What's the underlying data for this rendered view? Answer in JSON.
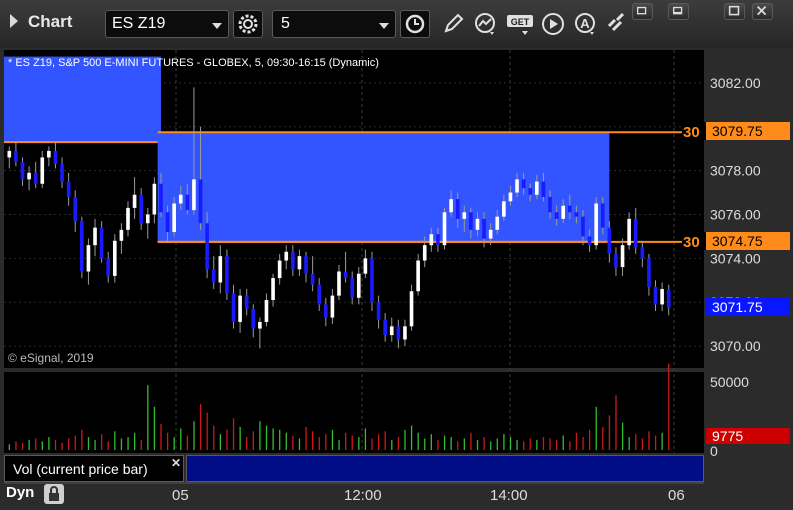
{
  "app": {
    "title": "Chart",
    "symbol": "ES Z19",
    "interval": "5"
  },
  "toolbar": {
    "icons": [
      "gear-icon",
      "clock-icon",
      "pencil-icon",
      "study-icon",
      "get-icon",
      "play-icon",
      "alert-icon",
      "link-icon"
    ],
    "get_label": "GET"
  },
  "window_controls": [
    "restore-icon",
    "minimize-icon",
    "maximize-icon",
    "close-icon"
  ],
  "chart_info": "* ES Z19, S&P 500 E-MINI FUTURES - GLOBEX, 5, 09:30-16:15 (Dynamic)",
  "copyright": "© eSignal, 2019",
  "price_axis": {
    "ticks": [
      "3082.00",
      "3080.00",
      "3078.00",
      "3076.00",
      "3074.00",
      "3072.00",
      "3070.00"
    ],
    "upper_label": "3079.75",
    "lower_label": "3074.75",
    "current_label": "3071.75",
    "box_prefix": "30"
  },
  "volume_axis": {
    "ticks": [
      "50000",
      "0"
    ],
    "current_label": "9775",
    "title": "Vol (current price bar)"
  },
  "time_axis": {
    "ticks": [
      "05",
      "12:00",
      "14:00",
      "06"
    ]
  },
  "status": {
    "mode": "Dyn"
  },
  "colors": {
    "background": "#000000",
    "up_candle": "#ffffff",
    "down_candle": "#1a1aff",
    "zone": "#3355ff",
    "zone_line": "#ff8c1a",
    "upper_label_bg": "#ff8c1a",
    "current_label_bg": "#0a16ff",
    "volume_current_bg": "#cc0000",
    "vol_up": "#2fbf2f",
    "vol_down": "#d01818"
  },
  "chart_data": {
    "type": "candlestick",
    "title": "* ES Z19, S&P 500 E-MINI FUTURES - GLOBEX, 5, 09:30-16:15 (Dynamic)",
    "ylim": [
      3069.0,
      3083.5
    ],
    "x_ticks": [
      "05",
      "12:00",
      "14:00",
      "06"
    ],
    "zones": [
      {
        "y_high": 3083.2,
        "y_low": 3079.3,
        "x_start_bar": 0,
        "x_end_bar": 23
      },
      {
        "y_high": 3079.75,
        "y_low": 3074.75,
        "x_start_bar": 23,
        "x_end_bar": 91
      }
    ],
    "candles": [
      [
        3078.6,
        3079.1,
        3078.1,
        3078.9
      ],
      [
        3078.9,
        3079.3,
        3078.2,
        3078.4
      ],
      [
        3078.4,
        3078.6,
        3077.3,
        3077.6
      ],
      [
        3077.6,
        3078.2,
        3077.1,
        3077.9
      ],
      [
        3077.9,
        3078.4,
        3077.2,
        3077.4
      ],
      [
        3077.4,
        3078.9,
        3077.2,
        3078.6
      ],
      [
        3078.6,
        3079.1,
        3078.2,
        3078.9
      ],
      [
        3078.9,
        3079.3,
        3078.1,
        3078.3
      ],
      [
        3078.3,
        3078.6,
        3077.2,
        3077.5
      ],
      [
        3077.5,
        3077.9,
        3076.4,
        3076.8
      ],
      [
        3076.8,
        3077.1,
        3075.2,
        3075.7
      ],
      [
        3075.7,
        3075.9,
        3073.1,
        3073.4
      ],
      [
        3073.4,
        3074.9,
        3072.8,
        3074.6
      ],
      [
        3074.6,
        3075.8,
        3074.1,
        3075.4
      ],
      [
        3075.4,
        3075.7,
        3073.8,
        3074.0
      ],
      [
        3074.0,
        3074.3,
        3072.9,
        3073.2
      ],
      [
        3073.2,
        3075.1,
        3072.9,
        3074.8
      ],
      [
        3074.8,
        3075.6,
        3074.2,
        3075.3
      ],
      [
        3075.3,
        3076.6,
        3075.0,
        3076.3
      ],
      [
        3076.3,
        3077.7,
        3075.8,
        3076.9
      ],
      [
        3076.9,
        3077.2,
        3075.3,
        3075.6
      ],
      [
        3075.6,
        3076.3,
        3074.9,
        3076.0
      ],
      [
        3076.0,
        3077.7,
        3075.6,
        3077.4
      ],
      [
        3077.4,
        3077.9,
        3075.9,
        3076.1
      ],
      [
        3076.1,
        3076.4,
        3074.8,
        3075.2
      ],
      [
        3075.2,
        3076.8,
        3075.0,
        3076.5
      ],
      [
        3076.5,
        3077.3,
        3076.2,
        3076.9
      ],
      [
        3076.9,
        3077.4,
        3076.0,
        3076.2
      ],
      [
        3076.2,
        3081.8,
        3076.0,
        3077.6
      ],
      [
        3077.6,
        3080.0,
        3075.3,
        3075.6
      ],
      [
        3075.6,
        3076.1,
        3073.1,
        3073.5
      ],
      [
        3073.5,
        3074.1,
        3072.6,
        3072.9
      ],
      [
        3072.9,
        3074.6,
        3072.4,
        3074.1
      ],
      [
        3074.1,
        3074.4,
        3072.1,
        3072.4
      ],
      [
        3072.4,
        3072.8,
        3070.8,
        3071.1
      ],
      [
        3071.1,
        3072.6,
        3070.6,
        3072.3
      ],
      [
        3072.3,
        3072.6,
        3071.4,
        3071.7
      ],
      [
        3071.7,
        3071.9,
        3070.4,
        3070.8
      ],
      [
        3070.8,
        3071.3,
        3069.9,
        3071.1
      ],
      [
        3071.1,
        3072.4,
        3070.9,
        3072.1
      ],
      [
        3072.1,
        3073.3,
        3071.8,
        3073.1
      ],
      [
        3073.1,
        3074.2,
        3072.8,
        3073.9
      ],
      [
        3073.9,
        3074.6,
        3073.5,
        3074.3
      ],
      [
        3074.3,
        3074.6,
        3073.2,
        3073.5
      ],
      [
        3073.5,
        3074.4,
        3073.2,
        3074.1
      ],
      [
        3074.1,
        3074.3,
        3072.9,
        3073.3
      ],
      [
        3073.3,
        3074.1,
        3072.5,
        3072.8
      ],
      [
        3072.8,
        3073.1,
        3071.6,
        3071.9
      ],
      [
        3071.9,
        3072.2,
        3070.9,
        3071.3
      ],
      [
        3071.3,
        3072.6,
        3071.0,
        3072.3
      ],
      [
        3072.3,
        3073.7,
        3072.1,
        3073.4
      ],
      [
        3073.4,
        3074.3,
        3072.9,
        3073.1
      ],
      [
        3073.1,
        3073.4,
        3071.9,
        3072.2
      ],
      [
        3072.2,
        3073.6,
        3071.9,
        3073.3
      ],
      [
        3073.3,
        3074.4,
        3073.1,
        3074.0
      ],
      [
        3074.0,
        3074.3,
        3071.6,
        3072.0
      ],
      [
        3072.0,
        3072.3,
        3070.8,
        3071.2
      ],
      [
        3071.2,
        3071.5,
        3070.2,
        3070.5
      ],
      [
        3070.5,
        3071.3,
        3070.2,
        3070.9
      ],
      [
        3070.9,
        3071.2,
        3069.9,
        3070.3
      ],
      [
        3070.3,
        3071.2,
        3070.0,
        3070.9
      ],
      [
        3070.9,
        3072.8,
        3070.7,
        3072.5
      ],
      [
        3072.5,
        3074.2,
        3072.3,
        3073.9
      ],
      [
        3073.9,
        3075.0,
        3073.6,
        3074.6
      ],
      [
        3074.6,
        3075.4,
        3074.3,
        3075.1
      ],
      [
        3075.1,
        3075.4,
        3074.3,
        3074.6
      ],
      [
        3074.6,
        3076.3,
        3074.4,
        3076.1
      ],
      [
        3076.1,
        3077.1,
        3075.9,
        3076.7
      ],
      [
        3076.7,
        3077.0,
        3075.4,
        3075.8
      ],
      [
        3075.8,
        3076.4,
        3075.2,
        3076.1
      ],
      [
        3076.1,
        3076.3,
        3074.9,
        3075.3
      ],
      [
        3075.3,
        3076.1,
        3075.0,
        3075.8
      ],
      [
        3075.8,
        3076.1,
        3074.5,
        3074.9
      ],
      [
        3074.9,
        3075.6,
        3074.6,
        3075.3
      ],
      [
        3075.3,
        3076.2,
        3075.1,
        3075.9
      ],
      [
        3075.9,
        3076.9,
        3075.7,
        3076.6
      ],
      [
        3076.6,
        3077.3,
        3076.4,
        3077.0
      ],
      [
        3077.0,
        3077.9,
        3076.8,
        3077.6
      ],
      [
        3077.6,
        3077.9,
        3076.9,
        3077.2
      ],
      [
        3077.2,
        3077.4,
        3076.6,
        3076.9
      ],
      [
        3076.9,
        3077.8,
        3076.7,
        3077.5
      ],
      [
        3077.5,
        3077.9,
        3076.6,
        3076.8
      ],
      [
        3076.8,
        3077.1,
        3075.8,
        3076.1
      ],
      [
        3076.1,
        3076.4,
        3075.5,
        3075.8
      ],
      [
        3075.8,
        3076.7,
        3075.6,
        3076.4
      ],
      [
        3076.4,
        3076.9,
        3075.8,
        3076.1
      ],
      [
        3076.1,
        3076.4,
        3075.6,
        3075.9
      ],
      [
        3075.9,
        3076.2,
        3074.6,
        3075.0
      ],
      [
        3075.0,
        3075.3,
        3074.3,
        3074.6
      ],
      [
        3074.6,
        3076.8,
        3074.4,
        3076.5
      ],
      [
        3076.5,
        3076.8,
        3075.1,
        3075.4
      ],
      [
        3075.4,
        3075.7,
        3073.8,
        3074.2
      ],
      [
        3074.2,
        3074.5,
        3073.2,
        3073.6
      ],
      [
        3073.6,
        3074.9,
        3073.2,
        3074.6
      ],
      [
        3074.6,
        3076.1,
        3074.4,
        3075.8
      ],
      [
        3075.8,
        3076.3,
        3074.2,
        3074.5
      ],
      [
        3074.5,
        3074.8,
        3073.6,
        3074.0
      ],
      [
        3074.0,
        3074.2,
        3072.3,
        3072.7
      ],
      [
        3072.7,
        3073.0,
        3071.6,
        3071.9
      ],
      [
        3071.9,
        3072.9,
        3071.6,
        3072.6
      ],
      [
        3072.6,
        3072.8,
        3071.4,
        3071.75
      ]
    ],
    "volume": [
      4,
      6,
      5,
      7,
      8,
      6,
      9,
      7,
      5,
      8,
      10,
      14,
      9,
      7,
      11,
      6,
      13,
      8,
      9,
      12,
      7,
      45,
      30,
      18,
      12,
      9,
      15,
      10,
      20,
      32,
      26,
      17,
      11,
      14,
      22,
      16,
      9,
      13,
      20,
      17,
      15,
      14,
      12,
      10,
      8,
      16,
      13,
      9,
      11,
      14,
      7,
      12,
      10,
      9,
      15,
      8,
      11,
      13,
      7,
      9,
      14,
      17,
      12,
      8,
      11,
      7,
      10,
      9,
      6,
      8,
      12,
      7,
      9,
      6,
      8,
      11,
      9,
      7,
      6,
      8,
      7,
      9,
      8,
      7,
      10,
      6,
      12,
      9,
      14,
      30,
      16,
      24,
      38,
      19,
      9,
      11,
      8,
      13,
      10,
      12,
      9775
    ]
  }
}
